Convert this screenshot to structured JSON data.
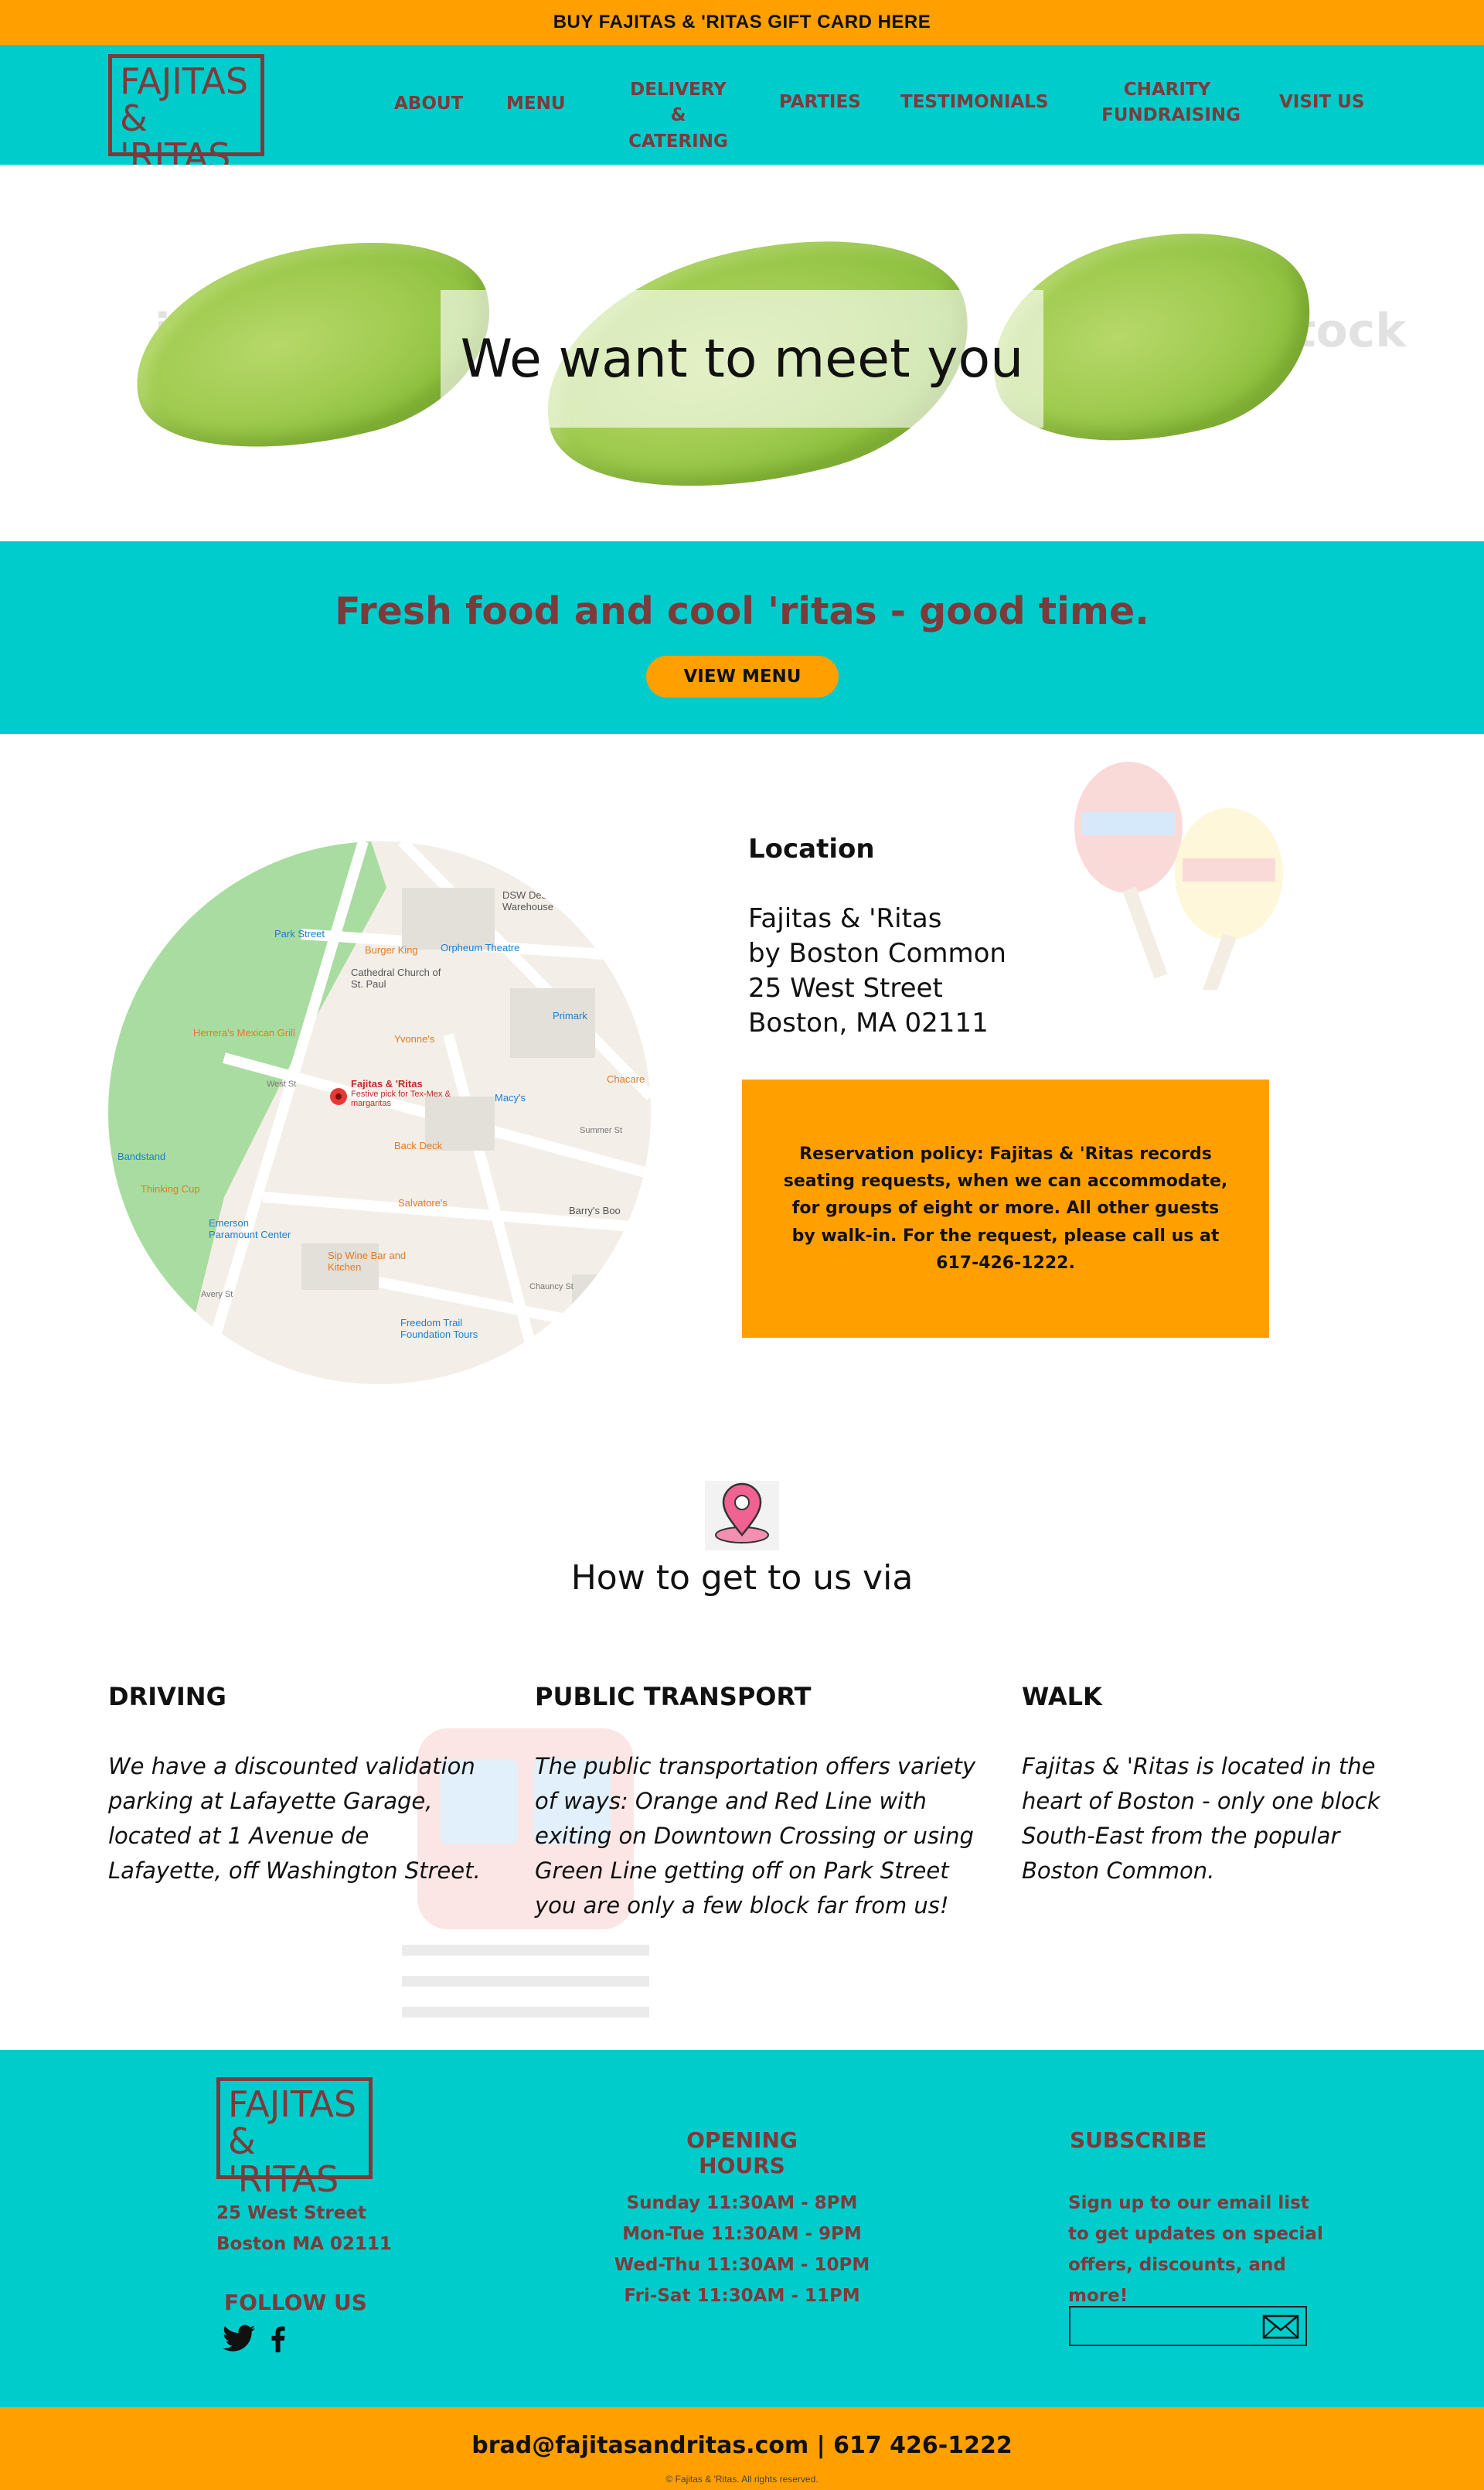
{
  "top_banner": {
    "label": "BUY FAJITAS & 'RITAS GIFT CARD HERE"
  },
  "header": {
    "logo_line1": "FAJITAS",
    "logo_line2": "& 'RITAS",
    "nav": {
      "about": "ABOUT",
      "menu": "MENU",
      "delivery_1": "DELIVERY",
      "delivery_2": "& CATERING",
      "parties": "PARTIES",
      "testimonials": "TESTIMONIALS",
      "charity_1": "CHARITY",
      "charity_2": "FUNDRAISING",
      "visit": "VISIT US"
    }
  },
  "hero": {
    "title": "We want to meet you",
    "watermark": "iStock"
  },
  "band": {
    "tagline": "Fresh food and cool 'ritas - good time.",
    "button": "VIEW MENU"
  },
  "map": {
    "labels": {
      "park_street": "Park Street",
      "burger_king": "Burger King",
      "orpheum": "Orpheum Theatre",
      "dsw": "DSW Designer Shoe Warehouse",
      "cathedral": "Cathedral Church of St. Paul",
      "herreras": "Herrera's Mexican Grill",
      "yvonnes": "Yvonne's",
      "primark": "Primark",
      "fajitas_pin": "Fajitas & 'Ritas",
      "fajitas_sub": "Festive pick for Tex-Mex & margaritas",
      "macys": "Macy's",
      "back_deck": "Back Deck",
      "salvatores": "Salvatore's",
      "emerson": "Emerson Paramount Center",
      "sip": "Sip Wine Bar and Kitchen",
      "barrys": "Barry's Boo",
      "freedom": "Freedom Trail Foundation Tours",
      "bandstand": "Bandstand",
      "thinking": "Thinking Cup",
      "chacarero": "Chacare",
      "west_st": "West St",
      "summer_st": "Summer St",
      "chauncy": "Chauncy St",
      "avery": "Avery St"
    }
  },
  "location": {
    "heading": "Location",
    "line1": "Fajitas & 'Ritas",
    "line2": "by Boston Common",
    "line3": "25 West Street",
    "line4": "Boston, MA 02111",
    "policy": "Reservation policy: Fajitas & 'Ritas records seating requests, when we can accommodate, for groups of eight or more. All other guests by walk-in. For the request, please call us at 617-426-1222."
  },
  "directions": {
    "title": "How to get to us via",
    "driving": {
      "heading": "DRIVING",
      "lines": [
        "We have a discounted validation",
        "parking at Lafayette Garage,",
        "located at 1 Avenue de",
        "Lafayette, off Washington Street."
      ]
    },
    "transport": {
      "heading": "PUBLIC TRANSPORT",
      "lines": [
        "The public transportation offers variety",
        "of ways:  Orange and Red Line with",
        "exiting on Downtown Crossing or using",
        "Green Line getting off on Park Street",
        "you are only a few block far from us!"
      ]
    },
    "walk": {
      "heading": "WALK",
      "lines": [
        "Fajitas & 'Ritas is located in the",
        "heart of Boston -  only one block",
        "South-East from the popular",
        "Boston Common."
      ]
    }
  },
  "footer": {
    "logo_line1": "FAJITAS",
    "logo_line2": "& 'RITAS",
    "address1": "25 West Street",
    "address2": "Boston MA 02111",
    "follow": "FOLLOW US",
    "hours_heading": "OPENING HOURS",
    "hours": [
      "Sunday 11:30AM - 8PM",
      "Mon-Tue 11:30AM - 9PM",
      "Wed-Thu 11:30AM - 10PM",
      "Fri-Sat 11:30AM - 11PM"
    ],
    "subscribe_heading": "SUBSCRIBE",
    "subscribe_text": [
      "Sign up to our email list",
      "to get updates on special",
      "offers, discounts, and",
      "more!"
    ],
    "contact": "brad@fajitasandritas.com  |  617 426-1222",
    "copyright": "© Fajitas & 'Ritas. All rights reserved."
  },
  "colors": {
    "teal": "#00cccc",
    "orange": "#ffa000",
    "brand_brown": "#7b3b3b"
  }
}
